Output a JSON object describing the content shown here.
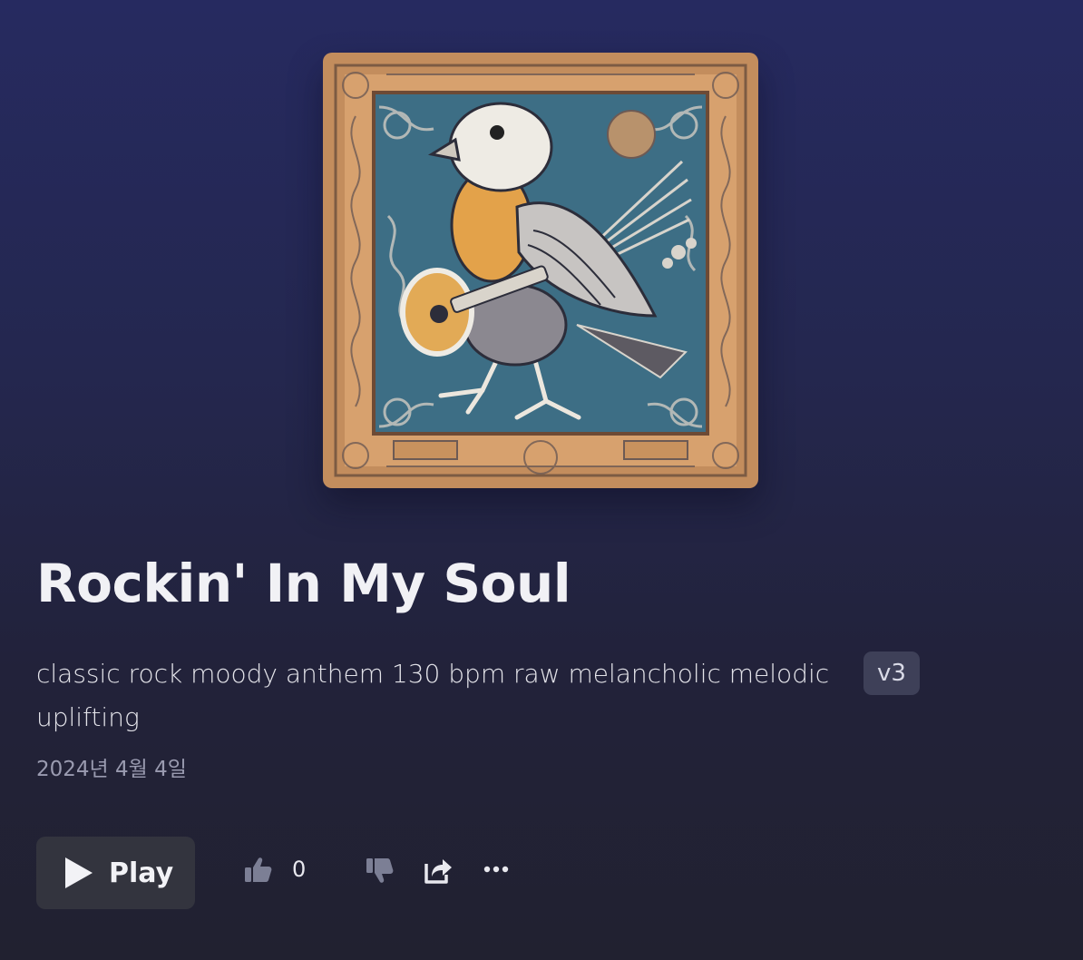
{
  "song": {
    "title": "Rockin' In My Soul",
    "description": "classic rock moody anthem 130 bpm raw melancholic melodic uplifting",
    "version": "v3",
    "date": "2024년 4월 4일",
    "cover_art_icon": "bird-with-mandolin-cover-art"
  },
  "actions": {
    "play_label": "Play",
    "like_count": "0",
    "icons": [
      "play-icon",
      "thumbs-up-icon",
      "thumbs-down-icon",
      "share-icon",
      "more-icon"
    ]
  },
  "colors": {
    "background_top": "#262a60",
    "background_bottom": "#212130",
    "badge_background": "#3e4058",
    "button_background": "#33343e"
  }
}
